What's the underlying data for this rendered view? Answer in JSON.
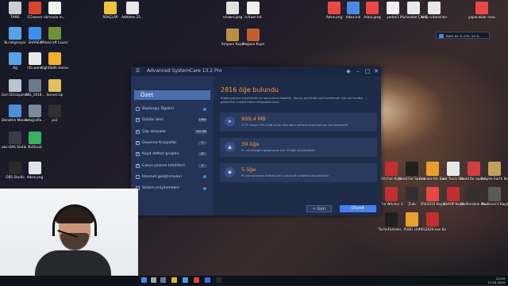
{
  "desktop": {
    "icons_left": [
      {
        "label": "TAMS",
        "color": "#c9cfd6"
      },
      {
        "label": "CCleaner",
        "color": "#d8452e"
      },
      {
        "label": "ekmoule m...",
        "color": "#f2f2f2"
      },
      {
        "label": "Bu bilgisayar",
        "color": "#5aa2e6"
      },
      {
        "label": "SHAREit",
        "color": "#3d8ff0"
      },
      {
        "label": "Minecraft Launcher",
        "color": "#6f8f3a"
      },
      {
        "label": "Ağ",
        "color": "#5aa2e6"
      },
      {
        "label": "nfo.world",
        "color": "#e8e8e8"
      },
      {
        "label": "Lightfaith Hamachi",
        "color": "#f0b030"
      },
      {
        "label": "Geri Dönüşüm...",
        "color": "#b8c4d0"
      },
      {
        "label": "IMG_2018...",
        "color": "#6a7c8e"
      },
      {
        "label": "Server.zip",
        "color": "#e0c060"
      },
      {
        "label": "Denetim Masası",
        "color": "#4f8fd8"
      },
      {
        "label": "fotoğrafla...",
        "color": "#7a8a9a"
      },
      {
        "label": "ps2",
        "color": "#303030"
      },
      {
        "label": "obs-OAS Statik 10 Deney",
        "color": "#3a3a4a"
      },
      {
        "label": "AirDroid",
        "color": "#3ab060"
      },
      {
        "label": "OBS Studio",
        "color": "#2a2a2a"
      },
      {
        "label": "Adsız.png",
        "color": "#e0e4ea"
      }
    ],
    "icons_top": [
      {
        "label": "ARAÇLAR",
        "color": "#f0c040"
      },
      {
        "label": "AdAdms.25...",
        "color": "#e8e8e8"
      },
      {
        "label": "schwer.jpeg",
        "color": "#e0e0e0"
      },
      {
        "label": "schwer.txt",
        "color": "#f0f0f0"
      },
      {
        "label": "Adsız.png",
        "color": "#e84848"
      },
      {
        "label": "Adsız.lnk",
        "color": "#4a8ae6"
      },
      {
        "label": "Adsız.jpeg",
        "color": "#e84848"
      },
      {
        "label": "yedek1",
        "color": "#f0f0f0"
      },
      {
        "label": "Muhasebe ÇALIŞM...",
        "color": "#e8e8e8"
      },
      {
        "label": "boku vitaminler",
        "color": "#e8e8e8"
      },
      {
        "label": "yapacaklar masaüstü",
        "color": "#e84848"
      },
      {
        "label": "Ampara Kayıt",
        "color": "#b89040"
      },
      {
        "label": "Mağaza Kayıt",
        "color": "#c06030"
      }
    ],
    "icons_games": [
      {
        "label": "Witcher Kayıt",
        "color": "#c03030"
      },
      {
        "label": "Need For Speed The...",
        "color": "#202020"
      },
      {
        "label": "Counter-Str. Global Offe...",
        "color": "#e8a030"
      },
      {
        "label": "Euro Truck Sim...",
        "color": "#e8e8e8"
      },
      {
        "label": "Need for speed...",
        "color": "#d04040"
      },
      {
        "label": "Empire Earth Kayıt",
        "color": "#c0a060"
      },
      {
        "label": "The Witcher 3",
        "color": "#c03030"
      },
      {
        "label": "Zula",
        "color": "#303030"
      },
      {
        "label": "FRA2015 Kayıt",
        "color": "#e84848"
      },
      {
        "label": "WolfOP Kayıt",
        "color": "#c03030"
      },
      {
        "label": "Wolfenstein Youngblood",
        "color": "#303030"
      },
      {
        "label": "Medieval II Kayıt",
        "color": "#5a5a5a"
      },
      {
        "label": "TechnFortress...",
        "color": "#202020"
      },
      {
        "label": "PUBG Lite",
        "color": "#e8a030"
      },
      {
        "label": "PES2020.exe Kayıt",
        "color": "#c03030"
      }
    ]
  },
  "ram_widget": {
    "text": "RAM: 64 %   CPU: 24 %"
  },
  "asc": {
    "window_title": "Advanced SystemCare 13.2 Pro",
    "sidebar_header": "Özet",
    "sidebar_items": [
      {
        "label": "Başlangıç Öğeleri",
        "checked": false,
        "badge": ""
      },
      {
        "label": "Gizlilik izleri",
        "checked": true,
        "badge": "1990"
      },
      {
        "label": "Çöp dosyalar",
        "checked": true,
        "badge": "782 MB"
      },
      {
        "label": "Geçersiz Kısayollar",
        "checked": true,
        "badge": "0"
      },
      {
        "label": "Kayıt defteri girişleri",
        "checked": true,
        "badge": "20"
      },
      {
        "label": "Casus yazılım tehditleri",
        "checked": true,
        "badge": "0"
      },
      {
        "label": "İnternet geliştirmeleri",
        "checked": false,
        "badge": ""
      },
      {
        "label": "Sistem eniyilemeleri",
        "checked": false,
        "badge": ""
      }
    ],
    "main_title": "2816 öğe bulundu",
    "main_desc": "Bilgisayarınız eniyilemeli ve sorunların düzeltin. Ayrıca ayrıntıları görüntülemek için sol tarafta gösterilen modül adına tıklayabilirsiniz.",
    "cards": [
      {
        "value": "939,4 MB",
        "desc": "2772 dosya 939,4 MB kadar disk alanı serbest bırakmak için temizlenebilir.",
        "icon": "paper-plane-icon"
      },
      {
        "value": "39 öğe",
        "desc": "PC verimliliğini geliştirmek için 39 öğe eniyilenebilir.",
        "icon": "rocket-icon"
      },
      {
        "value": "5 öğe",
        "desc": "PC'nizi güvende tutmak için 5 güvenlik problemi düzeltilebilir.",
        "icon": "shield-icon"
      }
    ],
    "back_label": "< Geri",
    "fix_label": "Düzelt"
  },
  "taskbar": {
    "time": "22:49",
    "date": "17.05.2020"
  }
}
